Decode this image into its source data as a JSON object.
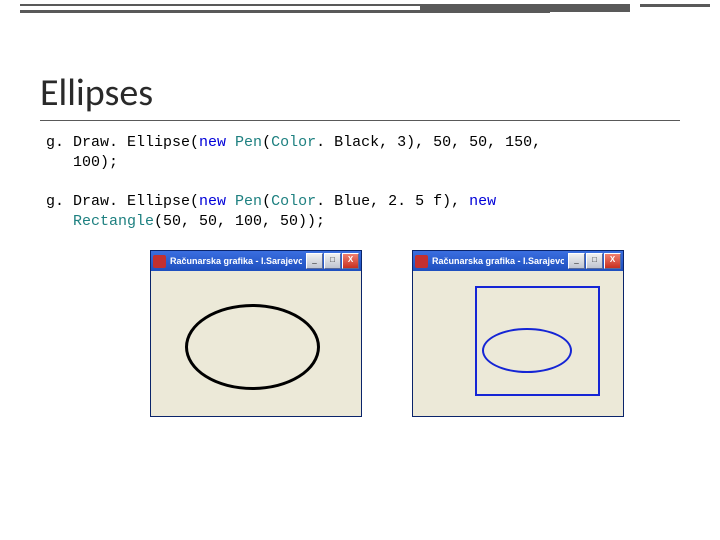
{
  "slide": {
    "title": "Ellipses"
  },
  "code": {
    "line1_a": "g. Draw. Ellipse(",
    "line1_kw1": "new",
    "line1_typ1": " Pen",
    "line1_b": "(",
    "line1_typ2": "Color",
    "line1_c": ". Black, 3), 50, 50, 150,",
    "line1_d": "100);",
    "line2_a": "g. Draw. Ellipse(",
    "line2_kw1": "new",
    "line2_typ1": " Pen",
    "line2_b": "(",
    "line2_typ2": "Color",
    "line2_c": ". Blue, 2. 5 f), ",
    "line2_kw2": "new",
    "line2_typ3": "Rectangle",
    "line2_d": "(50, 50, 100, 50));"
  },
  "window": {
    "title": "Računarska grafika - I.Sarajevo",
    "min": "_",
    "max": "□",
    "close": "X"
  }
}
